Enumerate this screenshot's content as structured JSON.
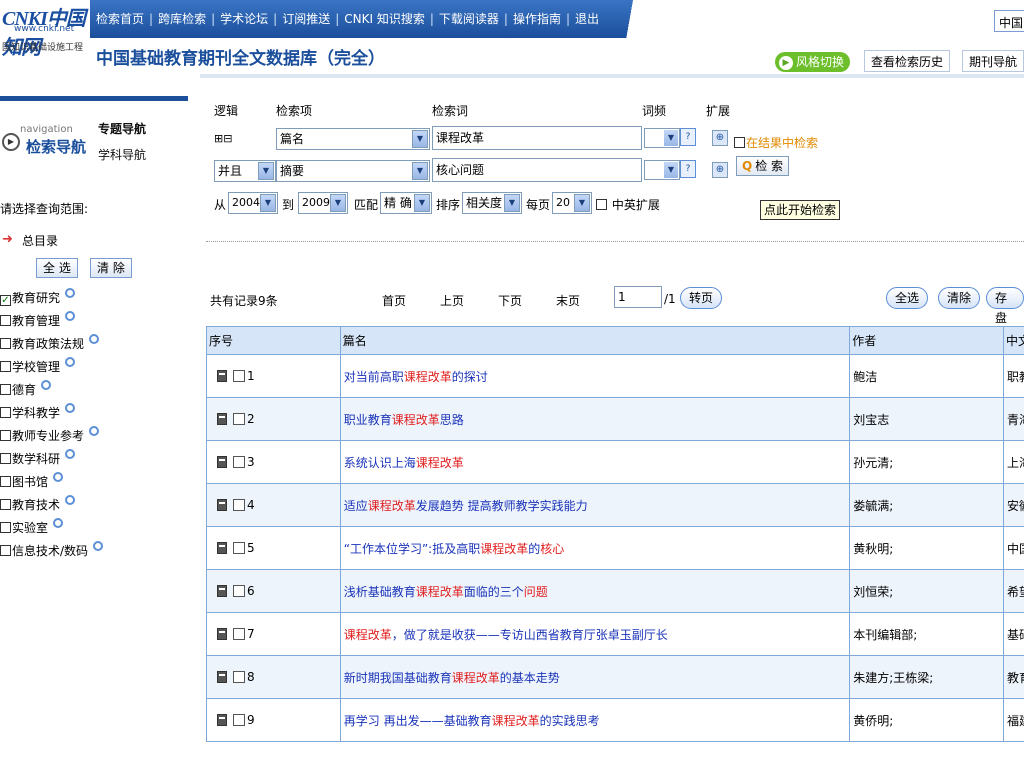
{
  "header": {
    "logo_text": "CNKI中国知网",
    "logo_url": "www.cnki.net",
    "logo_sub": "国知识基础设施工程",
    "nav_links": [
      "检索首页",
      "跨库检索",
      "学术论坛",
      "订阅推送",
      "CNKI 知识搜索",
      "下载阅读器",
      "操作指南",
      "退出"
    ],
    "db_title": "中国基础教育期刊全文数据库（完全）",
    "lang_value": "中国",
    "style_switch": "风格切换",
    "history_tab": "查看检索历史",
    "journal_tab": "期刊导航"
  },
  "sidebar": {
    "nav_small": "navigation",
    "nav_big": "检索导航",
    "topic_nav": "专题导航",
    "subject_nav": "学科导航",
    "scope_label": "请选择查询范围:",
    "root": "总目录",
    "select_all": "全 选",
    "clear": "清 除",
    "categories": [
      {
        "label": "教育研究",
        "checked": true
      },
      {
        "label": "教育管理",
        "checked": false
      },
      {
        "label": "教育政策法规",
        "checked": false
      },
      {
        "label": "学校管理",
        "checked": false
      },
      {
        "label": "德育",
        "checked": false
      },
      {
        "label": "学科教学",
        "checked": false
      },
      {
        "label": "教师专业参考",
        "checked": false
      },
      {
        "label": "数学科研",
        "checked": false
      },
      {
        "label": "图书馆",
        "checked": false
      },
      {
        "label": "教育技术",
        "checked": false
      },
      {
        "label": "实验室",
        "checked": false
      },
      {
        "label": "信息技术/数码",
        "checked": false
      }
    ]
  },
  "search": {
    "hdr_logic": "逻辑",
    "hdr_field": "检索项",
    "hdr_term": "检索词",
    "hdr_freq": "词频",
    "hdr_ext": "扩展",
    "plusminus": "⊞⊟",
    "row1_field": "篇名",
    "row1_term": "课程改革",
    "row2_logic": "并且",
    "row2_field": "摘要",
    "row2_term": "核心问题",
    "in_results": "在结果中检索",
    "search_btn": "检 索",
    "from": "从",
    "year_from": "2004",
    "to": "到",
    "year_to": "2009",
    "match": "匹配",
    "match_val": "精 确",
    "sort": "排序",
    "sort_val": "相关度",
    "per_page": "每页",
    "per_page_val": "20",
    "cn_en": "中英扩展",
    "tooltip": "点此开始检索"
  },
  "pager": {
    "total": "共有记录9条",
    "first": "首页",
    "prev": "上页",
    "next": "下页",
    "last": "末页",
    "page": "1",
    "of": "/1",
    "go": "转页",
    "select_all": "全选",
    "clear": "清除",
    "save": "存盘"
  },
  "table": {
    "headers": [
      "序号",
      "篇名",
      "作者",
      "中文"
    ],
    "rows": [
      {
        "no": "1",
        "title": [
          [
            "对当前高职",
            0
          ],
          [
            "课程改革",
            1
          ],
          [
            "的探讨",
            0
          ]
        ],
        "author": "鲍洁",
        "src": "职教"
      },
      {
        "no": "2",
        "title": [
          [
            "职业教育",
            0
          ],
          [
            "课程改革",
            1
          ],
          [
            "思路",
            0
          ]
        ],
        "author": "刘宝志",
        "src": "青海"
      },
      {
        "no": "3",
        "title": [
          [
            "系统认识上海",
            0
          ],
          [
            "课程改革",
            1
          ]
        ],
        "author": "孙元清;",
        "src": "上海"
      },
      {
        "no": "4",
        "title": [
          [
            "适应",
            0
          ],
          [
            "课程改革",
            1
          ],
          [
            "发展趋势  提高教师教学实践能力",
            0
          ]
        ],
        "author": "娄毓满;",
        "src": "安徽"
      },
      {
        "no": "5",
        "title": [
          [
            "“工作本位学习”:抵及高职",
            0
          ],
          [
            "课程改革",
            1
          ],
          [
            "的",
            0
          ],
          [
            "核心",
            1
          ]
        ],
        "author": "黄秋明;",
        "src": "中国"
      },
      {
        "no": "6",
        "title": [
          [
            "浅析基础教育",
            0
          ],
          [
            "课程改革",
            1
          ],
          [
            "面临的三个",
            0
          ],
          [
            "问题",
            1
          ]
        ],
        "author": "刘恒荣;",
        "src": "希望"
      },
      {
        "no": "7",
        "title": [
          [
            "课程改革",
            1
          ],
          [
            "，做了就是收获——专访山西省教育厅张卓玉副厅长",
            0
          ]
        ],
        "author": "本刊编辑部;",
        "src": "基础"
      },
      {
        "no": "8",
        "title": [
          [
            "新时期我国基础教育",
            0
          ],
          [
            "课程改革",
            1
          ],
          [
            "的基本走势",
            0
          ]
        ],
        "author": "朱建方;王栋梁;",
        "src": "教育"
      },
      {
        "no": "9",
        "title": [
          [
            "再学习  再出发——基础教育",
            0
          ],
          [
            "课程改革",
            1
          ],
          [
            "的实践思考",
            0
          ]
        ],
        "author": "黄侨明;",
        "src": "福建"
      }
    ]
  },
  "colors": {
    "brand": "#1b4f9c",
    "highlight": "#e02020",
    "link": "#1a33b8",
    "accent_green": "#6cbf2a"
  }
}
